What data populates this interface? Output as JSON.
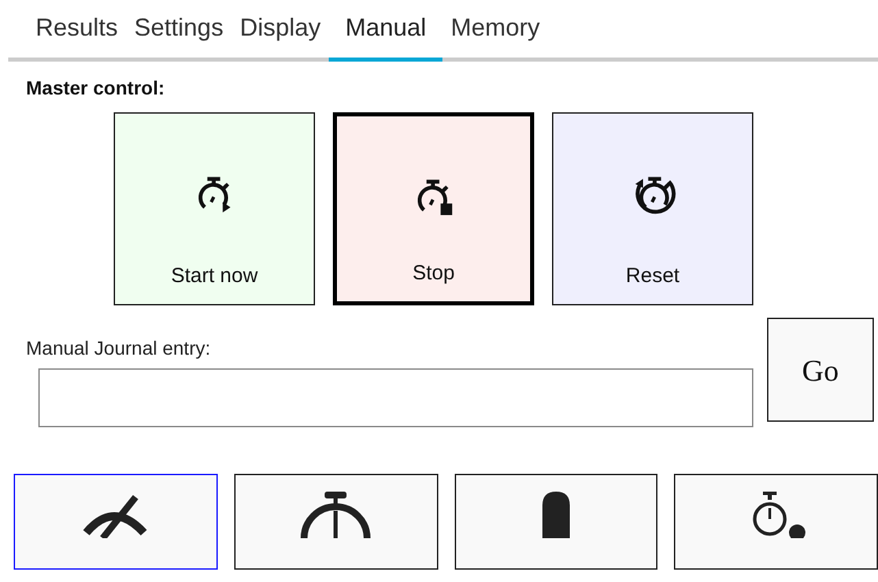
{
  "tabs": [
    {
      "label": "Results",
      "selected": false
    },
    {
      "label": "Settings",
      "selected": false
    },
    {
      "label": "Display",
      "selected": false
    },
    {
      "label": "Manual",
      "selected": true
    },
    {
      "label": "Memory",
      "selected": false
    }
  ],
  "master_control": {
    "label": "Master control:",
    "buttons": [
      {
        "kind": "start",
        "label": "Start now",
        "color": "#f0fef0",
        "selected": false
      },
      {
        "kind": "stop",
        "label": "Stop",
        "color": "#fdeeed",
        "selected": true
      },
      {
        "kind": "reset",
        "label": "Reset",
        "color": "#efeffd",
        "selected": false
      }
    ]
  },
  "journal": {
    "label": "Manual Journal entry:",
    "button": "Go"
  },
  "tool_buttons": [
    {
      "kind": "hidden",
      "selected": true
    },
    {
      "kind": "stopwatch",
      "selected": false
    },
    {
      "kind": "marker",
      "selected": false
    },
    {
      "kind": "timer-dot",
      "selected": false
    }
  ]
}
